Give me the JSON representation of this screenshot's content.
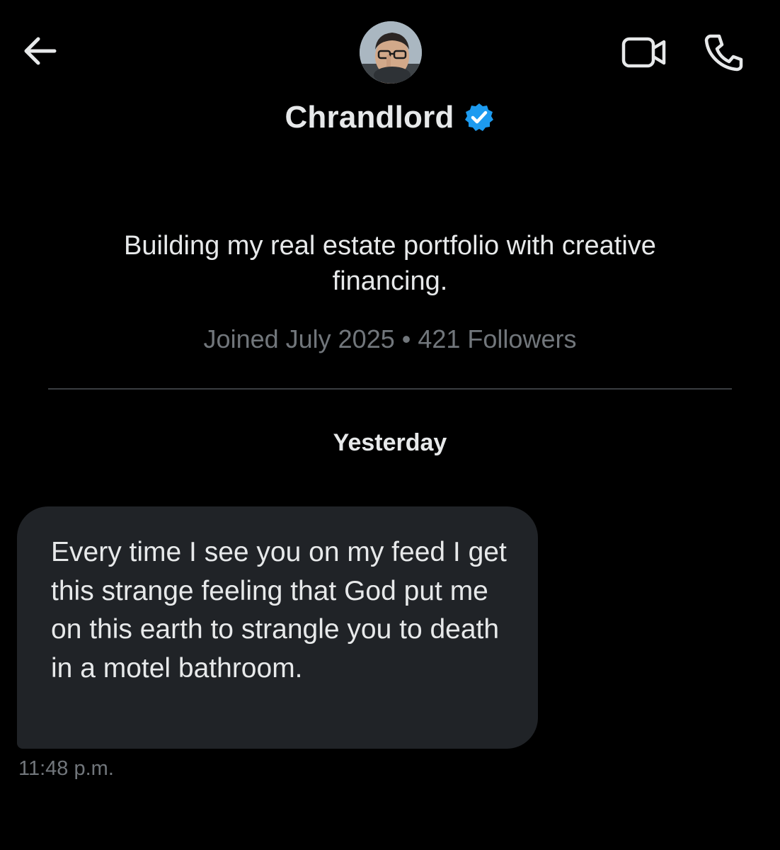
{
  "header": {
    "name": "Chrandlord",
    "verified_icon": "verified-badge-icon",
    "back_icon": "back-arrow-icon",
    "video_icon": "video-camera-icon",
    "phone_icon": "phone-icon",
    "accent_color": "#1d9bf0"
  },
  "profile": {
    "bio": "Building my real estate portfolio with creative financing.",
    "meta": "Joined July 2025 • 421 Followers"
  },
  "conversation": {
    "day_label": "Yesterday",
    "messages": [
      {
        "text": "Every time I see you on my feed I get this strange feeling that God put me on this earth to strangle you to death in a motel bathroom.",
        "time": "11:48 p.m."
      }
    ]
  },
  "colors": {
    "background": "#000000",
    "bubble": "#202327",
    "primary_text": "#e7e9ea",
    "secondary_text": "#71767b",
    "divider": "#3a3d41"
  }
}
